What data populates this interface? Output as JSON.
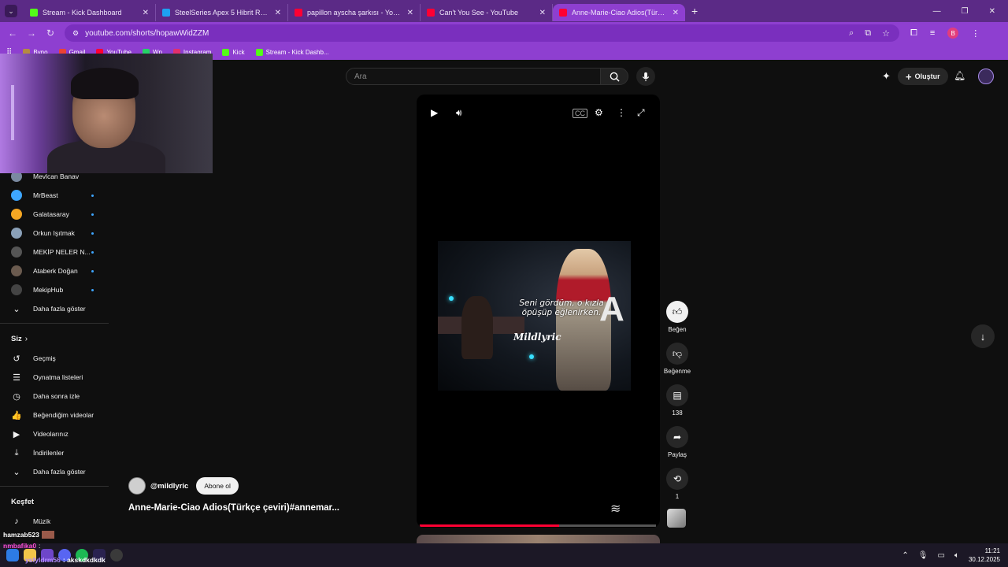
{
  "browser": {
    "tabs": [
      {
        "label": "Stream - Kick Dashboard",
        "color": "#53fc18",
        "active": false
      },
      {
        "label": "SteelSeries Apex 5 Hibrit RGB İ",
        "color": "#1da1f2",
        "active": false
      },
      {
        "label": "papillon ayscha şarkısı - YouTub",
        "color": "#ff0033",
        "active": false
      },
      {
        "label": "Can't You See - YouTube",
        "color": "#ff0033",
        "active": false
      },
      {
        "label": "Anne-Marie-Ciao Adios(Türkçe",
        "color": "#ff0033",
        "active": true
      }
    ],
    "url": "youtube.com/shorts/hopawWidZZM",
    "profile_initial": "B",
    "bookmarks": [
      {
        "label": "Byno",
        "color": "#b58b42"
      },
      {
        "label": "Gmail",
        "color": "#ea4335"
      },
      {
        "label": "YouTube",
        "color": "#ff0033"
      },
      {
        "label": "Wp",
        "color": "#25d366"
      },
      {
        "label": "Instagram",
        "color": "#e1306c"
      },
      {
        "label": "Kick",
        "color": "#53fc18"
      },
      {
        "label": "Stream - Kick Dashb...",
        "color": "#53fc18"
      }
    ]
  },
  "youtube": {
    "search_placeholder": "Ara",
    "create_label": "Oluştur",
    "subscriptions": [
      {
        "label": "Mevlcan Banav",
        "color": "#7a8aa0",
        "dot": false
      },
      {
        "label": "MrBeast",
        "color": "#3ea6ff",
        "dot": true
      },
      {
        "label": "Galatasaray",
        "color": "#f5a623",
        "dot": true
      },
      {
        "label": "Orkun Işıtmak",
        "color": "#8aa0b8",
        "dot": true
      },
      {
        "label": "MEKİP NELER N...",
        "color": "#555",
        "dot": true
      },
      {
        "label": "Ataberk Doğan",
        "color": "#6b5b4f",
        "dot": true
      },
      {
        "label": "MekipHub",
        "color": "#444",
        "dot": true
      }
    ],
    "show_more": "Daha fazla göster",
    "you_heading": "Siz",
    "you_items": [
      {
        "label": "Geçmiş",
        "icon": "history-icon",
        "glyph": "↺"
      },
      {
        "label": "Oynatma listeleri",
        "icon": "playlist-icon",
        "glyph": "☰"
      },
      {
        "label": "Daha sonra izle",
        "icon": "clock-icon",
        "glyph": "◷"
      },
      {
        "label": "Beğendiğim videolar",
        "icon": "thumb-up-icon",
        "glyph": "👍"
      },
      {
        "label": "Videolarınız",
        "icon": "video-icon",
        "glyph": "▶"
      },
      {
        "label": "İndirilenler",
        "icon": "download-icon",
        "glyph": "⤓"
      }
    ],
    "show_more_2": "Daha fazla göster",
    "explore_heading": "Keşfet",
    "explore_items": [
      {
        "label": "Müzik",
        "icon": "music-icon",
        "glyph": "♪"
      }
    ]
  },
  "video": {
    "lyric_line1": "Seni gördüm, o kızla",
    "lyric_line2": "öpüşüp eğlenirken.",
    "watermark": "Mildlyric",
    "big_letter": "A",
    "progress_fraction": 0.59,
    "channel": "@mildlyric",
    "subscribe_label": "Abone ol",
    "title": "Anne-Marie-Ciao Adios(Türkçe çeviri)#annemar..."
  },
  "actions": {
    "like_label": "Beğen",
    "dislike_label": "Beğenme",
    "comments_count": "138",
    "share_label": "Paylaş",
    "remix_count": "1"
  },
  "chat": {
    "line1_user": "hamzab523",
    "line1_text": "",
    "line2_user": "ysfyldrm56",
    "line2_text": ": akskdkdkdk",
    "line0_user": "nmbafika0",
    "line0_text": ":"
  },
  "system": {
    "time": "11:21",
    "date": "30.12.2025"
  }
}
